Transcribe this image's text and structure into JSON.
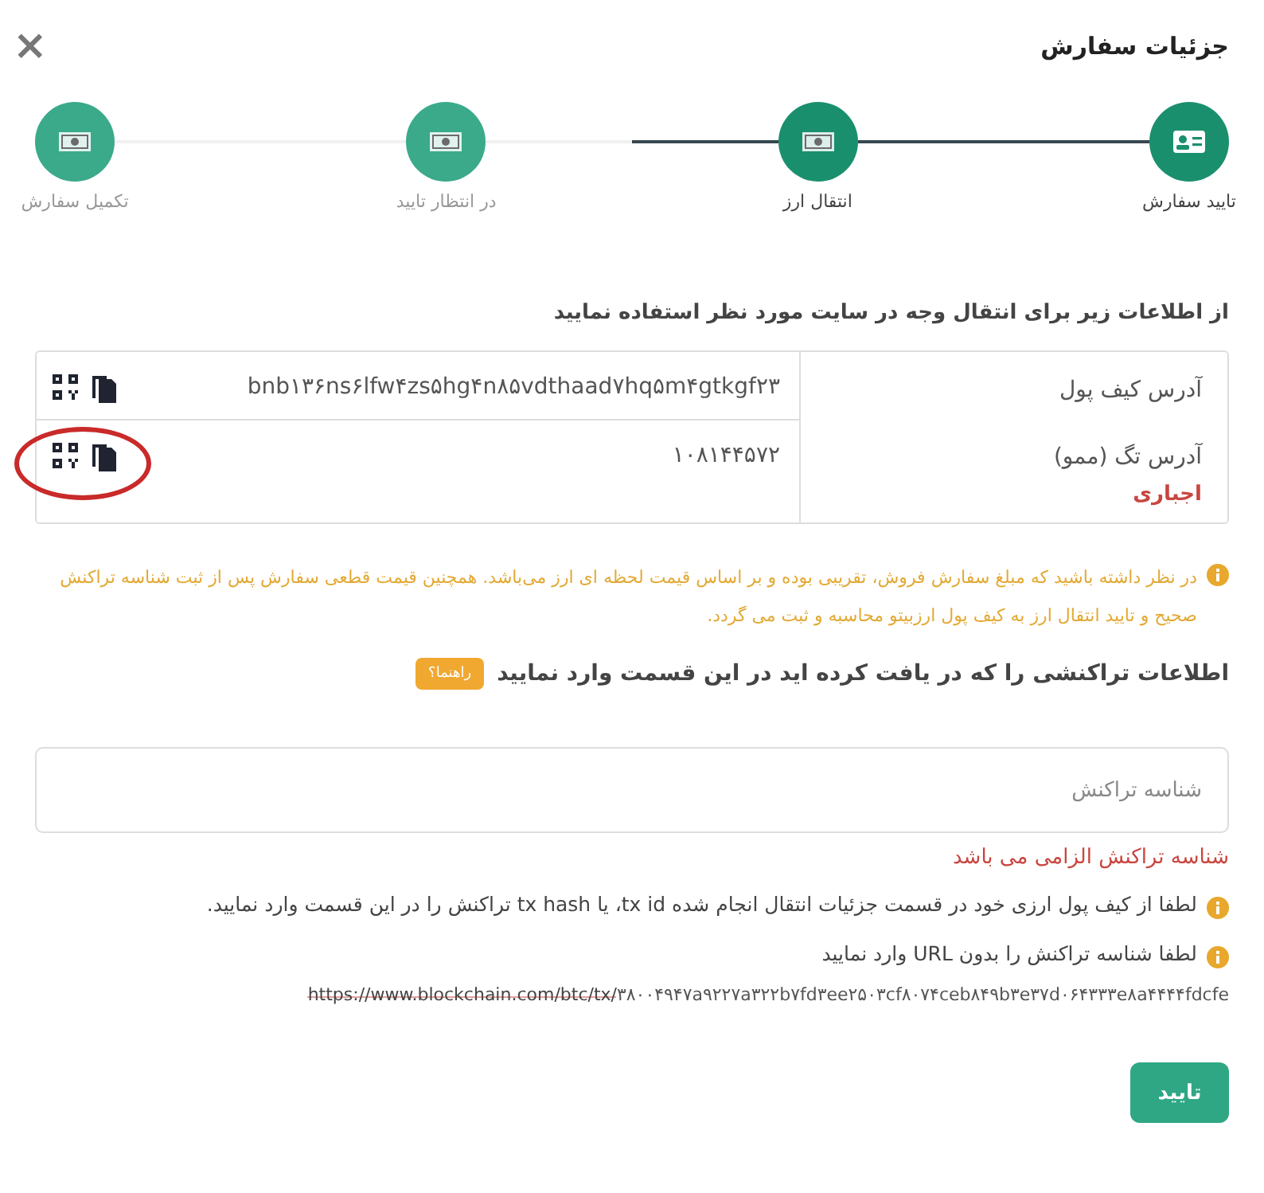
{
  "dialog": {
    "title": "جزئیات سفارش",
    "close": "×"
  },
  "steps": [
    {
      "label": "تایید سفارش",
      "reached": true
    },
    {
      "label": "انتقال ارز",
      "reached": true
    },
    {
      "label": "در انتظار تایید",
      "reached": false
    },
    {
      "label": "تکمیل سفارش",
      "reached": false
    }
  ],
  "intro": "از اطلاعات زیر برای انتقال وجه در سایت مورد نظر استفاده نمایید",
  "address_table": {
    "rows": [
      {
        "label": "آدرس کیف پول",
        "value": "bnb۱۳۶ns۶lfw۴zs۵hg۴n۸۵vdthaad۷hq۵m۴gtkgf۲۳",
        "circled": false
      },
      {
        "label": "آدرس تگ (ممو)",
        "note": "اجباری",
        "value": "۱۰۸۱۴۴۵۷۲",
        "circled": true
      }
    ]
  },
  "warning": "در نظر داشته باشید که مبلغ سفارش فروش، تقریبی بوده و بر اساس قیمت لحظه ای ارز می‌باشد. همچنین قیمت قطعی سفارش پس از ثبت شناسه تراکنش صحیح و تایید انتقال ارز به کیف پول ارزبیتو محاسبه و ثبت می گردد.",
  "tx_section": {
    "heading": "اطلاعات تراکنشی را که در یافت کرده اید در این قسمت وارد نمایید",
    "help_badge": "راهنما؟",
    "field": {
      "placeholder": "شناسه تراکنش"
    },
    "error": "شناسه تراکنش الزامی می باشد",
    "hints": [
      "لطفا از کیف پول ارزی خود در قسمت جزئیات انتقال انجام شده tx id، یا tx hash تراکنش را در این قسمت وارد نمایید.",
      "لطفا شناسه تراکنش را بدون URL وارد نمایید"
    ],
    "example_url": {
      "struck": "https://www.blockchain.com/btc/tx/",
      "rest": "۳۸۰۰۴۹۴۷a۹۲۲۷a۳۲۲b۷fd۳ee۲۵۰۳cf۸۰۷۴ceb۸۴۹b۳e۳۷d۰۶۴۳۳۳e۸a۴۴۴۴fdcfe"
    }
  },
  "submit": "تایید"
}
